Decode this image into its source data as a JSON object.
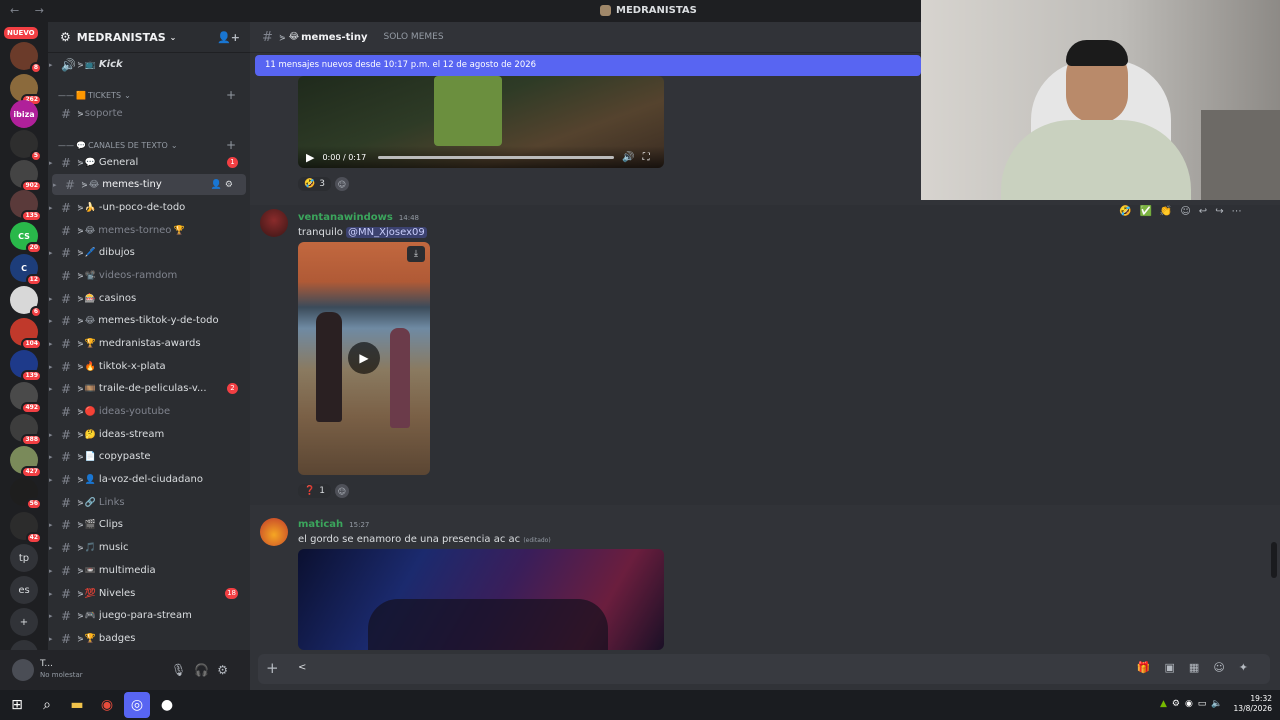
{
  "window": {
    "title": "MEDRANISTAS",
    "nav": "← →"
  },
  "server_rail": {
    "nuevo": "NUEVO",
    "servers": [
      {
        "label": "",
        "color": "#6b3b2a",
        "badge": "8"
      },
      {
        "label": "",
        "color": "#8b6a3c",
        "badge": "262"
      },
      {
        "label": "ibiza",
        "color": "#b0209a",
        "badge": ""
      },
      {
        "label": "",
        "color": "#2e2e2e",
        "badge": "5"
      },
      {
        "label": "",
        "color": "#444444",
        "badge": "902"
      },
      {
        "label": "",
        "color": "#5a3a3a",
        "badge": "135"
      },
      {
        "label": "CS",
        "color": "#29b84a",
        "badge": "20"
      },
      {
        "label": "C",
        "color": "#1d3d7a",
        "badge": "12"
      },
      {
        "label": "",
        "color": "#d8d8d8",
        "badge": "6"
      },
      {
        "label": "",
        "color": "#c0392b",
        "badge": "104"
      },
      {
        "label": "",
        "color": "#1e3a8a",
        "badge": "139"
      },
      {
        "label": "",
        "color": "#4a4a4a",
        "badge": "492"
      },
      {
        "label": "",
        "color": "#3d3d3d",
        "badge": "388"
      },
      {
        "label": "",
        "color": "#7a8a5a",
        "badge": "427"
      },
      {
        "label": "",
        "color": "#1e1e1e",
        "badge": "56"
      },
      {
        "label": "",
        "color": "#2c2c2c",
        "badge": "42"
      },
      {
        "label": "tp",
        "color": "",
        "badge": ""
      },
      {
        "label": "es",
        "color": "",
        "badge": ""
      },
      {
        "label": "+",
        "color": "",
        "badge": ""
      },
      {
        "label": "⊙",
        "color": "",
        "badge": ""
      }
    ]
  },
  "guild": {
    "name": "MEDRANISTAS",
    "chevron": "⌄"
  },
  "channels": {
    "items": [
      {
        "type": "channel",
        "emoji": "📺",
        "name": "Kick",
        "muted": false,
        "bold": true,
        "badge": "",
        "voice": true
      },
      {
        "type": "category",
        "name": "Tickets",
        "prefix": "——",
        "emoji": "🟧"
      },
      {
        "type": "channel",
        "emoji": "",
        "name": "soporte",
        "muted": true,
        "badge": ""
      },
      {
        "type": "category",
        "name": "CANALES DE TEXTO",
        "prefix": "——",
        "emoji": "💬"
      },
      {
        "type": "channel",
        "emoji": "💬",
        "name": "General",
        "muted": false,
        "badge": "1"
      },
      {
        "type": "channel",
        "emoji": "😂",
        "name": "memes-tiny",
        "muted": false,
        "badge": "",
        "active": true
      },
      {
        "type": "channel",
        "emoji": "🍌",
        "name": "-un-poco-de-todo",
        "muted": false,
        "badge": ""
      },
      {
        "type": "channel",
        "emoji": "😂",
        "name": "memes-torneo",
        "muted": true,
        "badge": "",
        "suffix": "🏆"
      },
      {
        "type": "channel",
        "emoji": "🖊️",
        "name": "dibujos",
        "muted": false,
        "badge": ""
      },
      {
        "type": "channel",
        "emoji": "📽️",
        "name": "videos-ramdom",
        "muted": true,
        "badge": ""
      },
      {
        "type": "channel",
        "emoji": "🎰",
        "name": "casinos",
        "muted": false,
        "badge": ""
      },
      {
        "type": "channel",
        "emoji": "😂",
        "name": "memes-tiktok-y-de-todo",
        "muted": false,
        "badge": ""
      },
      {
        "type": "channel",
        "emoji": "🏆",
        "name": "medranistas-awards",
        "muted": false,
        "badge": ""
      },
      {
        "type": "channel",
        "emoji": "🔥",
        "name": "tiktok-x-plata",
        "muted": false,
        "badge": ""
      },
      {
        "type": "channel",
        "emoji": "🎞️",
        "name": "traile-de-peliculas-v...",
        "muted": false,
        "badge": "2"
      },
      {
        "type": "channel",
        "emoji": "🔴",
        "name": "ideas-youtube",
        "muted": true,
        "badge": ""
      },
      {
        "type": "channel",
        "emoji": "🤔",
        "name": "ideas-stream",
        "muted": false,
        "badge": ""
      },
      {
        "type": "channel",
        "emoji": "📄",
        "name": "copypaste",
        "muted": false,
        "badge": ""
      },
      {
        "type": "channel",
        "emoji": "👤",
        "name": "la-voz-del-ciudadano",
        "muted": false,
        "badge": ""
      },
      {
        "type": "channel",
        "emoji": "🔗",
        "name": "Links",
        "muted": true,
        "badge": ""
      },
      {
        "type": "channel",
        "emoji": "🎬",
        "name": "Clips",
        "muted": false,
        "badge": ""
      },
      {
        "type": "channel",
        "emoji": "🎵",
        "name": "music",
        "muted": false,
        "badge": ""
      },
      {
        "type": "channel",
        "emoji": "📼",
        "name": "multimedia",
        "muted": false,
        "badge": ""
      },
      {
        "type": "channel",
        "emoji": "💯",
        "name": "Niveles",
        "muted": false,
        "badge": "18"
      },
      {
        "type": "channel",
        "emoji": "🎮",
        "name": "juego-para-stream",
        "muted": false,
        "badge": ""
      },
      {
        "type": "channel",
        "emoji": "🏆",
        "name": "badges",
        "muted": false,
        "badge": ""
      }
    ]
  },
  "user_panel": {
    "name": "T...",
    "status": "No molestar"
  },
  "header": {
    "channel_emoji": "😂",
    "channel_name": "memes-tiny",
    "topic": "SOLO MEMES"
  },
  "new_messages_bar": "11 mensajes nuevos desde 10:17 p.m. el 12 de agosto de 2026",
  "video1": {
    "time": "0:00 / 0:17",
    "reaction_emoji": "🤣",
    "reaction_count": "3"
  },
  "messages": [
    {
      "author": "ventanawindows",
      "author_color": "#3ba55c",
      "time": "14:48",
      "text": "tranquilo",
      "mention": "@MN_Xjosex09",
      "reaction_emoji": "❓",
      "reaction_count": "1"
    },
    {
      "author": "maticah",
      "author_color": "#3ba55c",
      "time": "15:27",
      "text": "el gordo se enamoro de una presencia ac ac",
      "edited": "(editado)"
    }
  ],
  "hover_toolbar": [
    "🤣",
    "✅",
    "👏",
    "☺",
    "↩",
    "↪",
    "⋯"
  ],
  "composer": {
    "plus": "+",
    "text": "<"
  },
  "taskbar": {
    "time": "19:32",
    "date": "13/8/2026"
  },
  "colors": {
    "accent": "#5865f2",
    "mention_bg": "#3c4270",
    "badge": "#f23f43",
    "username": "#3ba55c"
  }
}
